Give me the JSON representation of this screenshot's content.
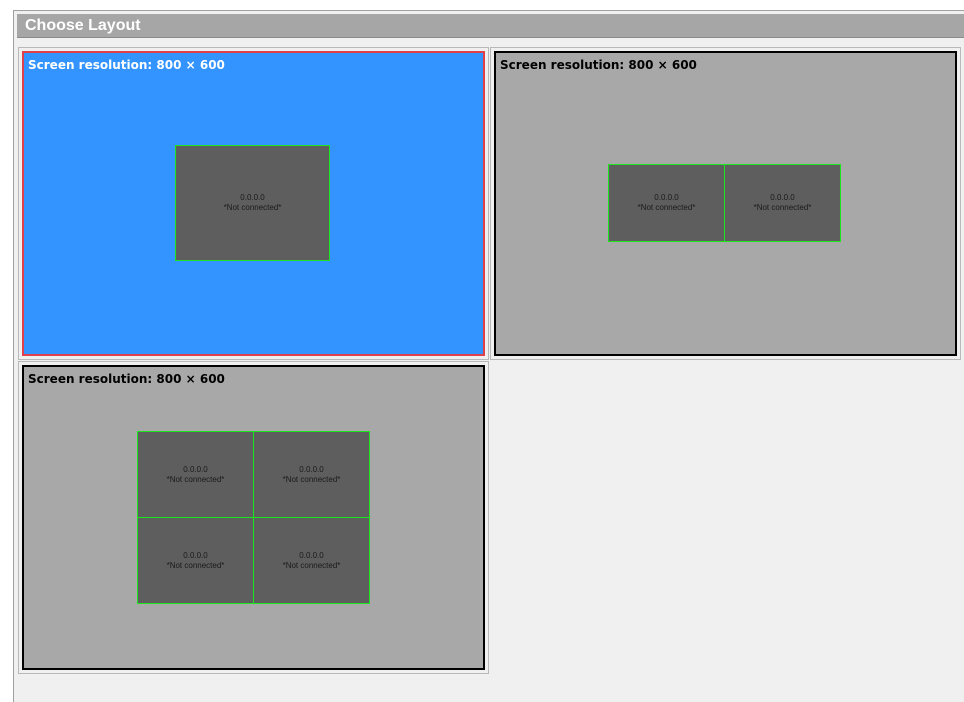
{
  "window": {
    "title": "Choose Layout"
  },
  "layouts": [
    {
      "resolution_label": "Screen resolution: 800 × 600",
      "selected": true,
      "monitors": [
        {
          "ip": "0.0.0.0",
          "status": "*Not connected*"
        }
      ]
    },
    {
      "resolution_label": "Screen resolution: 800 × 600",
      "selected": false,
      "monitors": [
        {
          "ip": "0.0.0.0",
          "status": "*Not connected*"
        },
        {
          "ip": "0.0.0.0",
          "status": "*Not connected*"
        }
      ]
    },
    {
      "resolution_label": "Screen resolution: 800 × 600",
      "selected": false,
      "monitors": [
        {
          "ip": "0.0.0.0",
          "status": "*Not connected*"
        },
        {
          "ip": "0.0.0.0",
          "status": "*Not connected*"
        },
        {
          "ip": "0.0.0.0",
          "status": "*Not connected*"
        },
        {
          "ip": "0.0.0.0",
          "status": "*Not connected*"
        }
      ]
    }
  ],
  "colors": {
    "selected_background": "#3394ff",
    "selected_border": "#e0404a",
    "unselected_background": "#a8a8a8",
    "monitor_fill": "#5e5e5e",
    "monitor_border": "#1ee61e"
  }
}
